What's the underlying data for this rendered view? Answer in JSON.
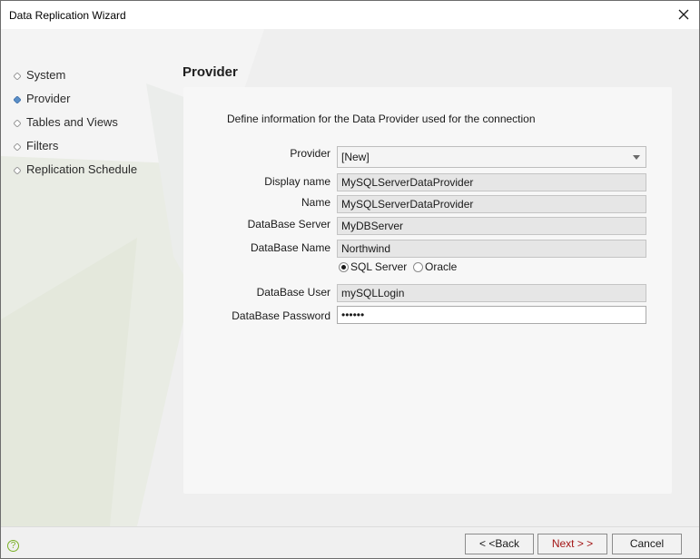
{
  "window": {
    "title": "Data Replication Wizard"
  },
  "steps": [
    {
      "label": "System",
      "active": false
    },
    {
      "label": "Provider",
      "active": true
    },
    {
      "label": "Tables and Views",
      "active": false
    },
    {
      "label": "Filters",
      "active": false
    },
    {
      "label": "Replication Schedule",
      "active": false
    }
  ],
  "page": {
    "heading": "Provider",
    "intro": "Define information for the Data Provider used for the connection"
  },
  "form": {
    "provider": {
      "label": "Provider",
      "value": "[New]"
    },
    "display_name": {
      "label": "Display name",
      "value": "MySQLServerDataProvider"
    },
    "name": {
      "label": "Name",
      "value": "MySQLServerDataProvider"
    },
    "db_server": {
      "label": "DataBase Server",
      "value": "MyDBServer"
    },
    "db_name": {
      "label": "DataBase Name",
      "value": "Northwind"
    },
    "db_type": {
      "options": [
        "SQL Server",
        "Oracle"
      ],
      "selected": "SQL Server"
    },
    "db_user": {
      "label": "DataBase User",
      "value": "mySQLLogin"
    },
    "db_password": {
      "label": "DataBase Password",
      "value": "••••••"
    }
  },
  "footer": {
    "back_label": "< <Back",
    "next_label": "Next > >",
    "cancel_label": "Cancel"
  },
  "icons": {
    "close": "close-icon",
    "help": "help-icon",
    "step_bullet": "diamond-icon",
    "dropdown": "chevron-down-icon"
  },
  "colors": {
    "active_step_bullet": "#5a8fc8",
    "inactive_step_bullet": "#9a9a9a",
    "help_accent": "#7ab026",
    "next_text": "#a31515"
  }
}
